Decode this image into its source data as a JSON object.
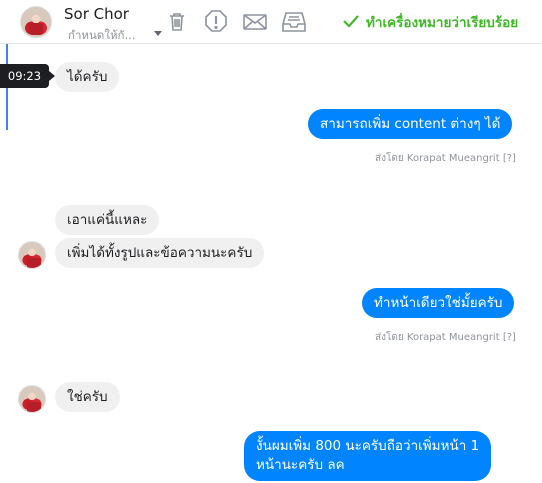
{
  "header": {
    "contact_name": "Sor Chor",
    "subtitle": "กำหนดให้กั...",
    "tools": {
      "delete": "trash-icon",
      "spam": "exclamation-icon",
      "unread": "envelope-icon",
      "archive": "archive-icon"
    },
    "done_label": "ทำเครื่องหมายว่าเรียบร้อย",
    "done_color": "#42b72a"
  },
  "tooltip_time": "09:23",
  "messages": [
    {
      "dir": "in",
      "text": "ได้ครับ"
    },
    {
      "dir": "out",
      "text": "สามารถเพิ่ม content ต่างๆ ได้"
    },
    {
      "dir": "out-meta",
      "text": "ส่งโดย Korapat Mueangrit",
      "help": "[?]"
    },
    {
      "dir": "in",
      "text": "เอาแค่นี้แหละ"
    },
    {
      "dir": "in",
      "text": "เพิ่มได้ทั้งรูปและข้อความนะครับ"
    },
    {
      "dir": "out",
      "text": "ทำหน้าเดียวใช่มั้ยครับ"
    },
    {
      "dir": "out-meta",
      "text": "ส่งโดย Korapat Mueangrit",
      "help": "[?]"
    },
    {
      "dir": "in",
      "text": "ใช่ครับ"
    },
    {
      "dir": "out",
      "line1": "งั้นผมเพิ่ม 800 นะครับถือว่าเพิ่มหน้า 1",
      "line2": "หน้านะครับ ลค"
    }
  ],
  "colors": {
    "outgoing": "#0084ff",
    "incoming": "#f1f0f0",
    "accent": "#4080ff"
  }
}
